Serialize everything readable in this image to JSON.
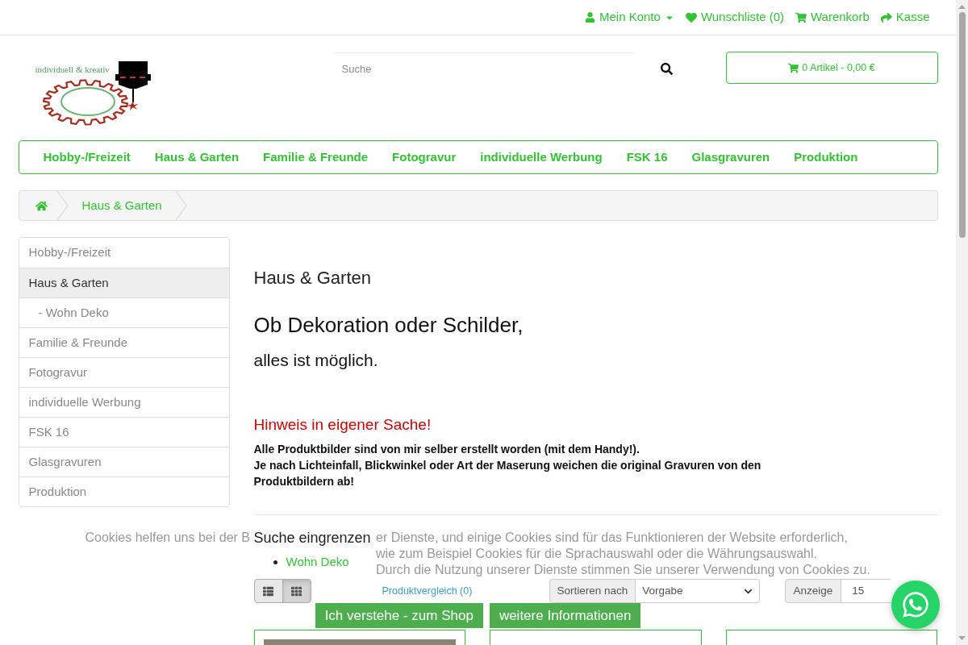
{
  "top_links": [
    {
      "kind": "account",
      "label": "Mein Konto",
      "dropdown": true
    },
    {
      "kind": "wishlist",
      "label": "Wunschliste (0)",
      "dropdown": false
    },
    {
      "kind": "cart",
      "label": "Warenkorb",
      "dropdown": false
    },
    {
      "kind": "checkout",
      "label": "Kasse",
      "dropdown": false
    }
  ],
  "logo": {
    "tagline": "individuell & kreativ"
  },
  "search": {
    "placeholder": "Suche"
  },
  "cart_button": {
    "label": "0 Artikel - 0,00 €"
  },
  "nav": [
    "Hobby-/Freizeit",
    "Haus & Garten",
    "Familie & Freunde",
    "Fotogravur",
    "individuelle Werbung",
    "FSK 16",
    "Glasgravuren",
    "Produktion"
  ],
  "breadcrumb": [
    {
      "kind": "home"
    },
    {
      "kind": "link",
      "label": "Haus & Garten"
    }
  ],
  "sidebar": {
    "items": [
      {
        "label": "Hobby-/Freizeit",
        "selected": false
      },
      {
        "label": "Haus & Garten",
        "selected": true,
        "children": [
          {
            "label": "- Wohn Deko",
            "selected": false
          }
        ]
      },
      {
        "label": "Familie & Freunde",
        "selected": false
      },
      {
        "label": "Fotogravur",
        "selected": false
      },
      {
        "label": "individuelle Werbung",
        "selected": false
      },
      {
        "label": "FSK 16",
        "selected": false
      },
      {
        "label": "Glasgravuren",
        "selected": false
      },
      {
        "label": "Produktion",
        "selected": false
      }
    ]
  },
  "content": {
    "title": "Haus & Garten",
    "headline": "Ob Dekoration oder Schilder,",
    "subline": "alles ist möglich.",
    "notice_title": "Hinweis in eigener Sache!",
    "notice_lines": [
      "Alle Produktbilder sind von mir selber erstellt worden (mit dem Handy!).",
      "Je nach Lichteinfall, Blickwinkel oder Art der Maserung weichen die original Gravuren von den Produktbildern ab!"
    ]
  },
  "refine": {
    "title": "Suche eingrenzen",
    "items": [
      "Wohn Deko"
    ]
  },
  "toolbar": {
    "view_buttons": [
      {
        "kind": "list",
        "selected": false
      },
      {
        "kind": "grid",
        "selected": true
      }
    ],
    "compare_link": "Produktvergleich (0)",
    "sort": {
      "label": "Sortieren nach",
      "value": "Vorgabe"
    },
    "limit": {
      "label": "Anzeige",
      "value": "15"
    }
  },
  "product_cards": [
    {
      "photo": true
    },
    {
      "photo": false
    },
    {
      "photo": false
    }
  ],
  "cookie_banner": {
    "lines": [
      {
        "parts": [
          "Cookies helfen uns bei der B",
          "er Dienste, und einige Cookies sind für das Funktionieren der Website erforderlich,"
        ]
      },
      {
        "parts": [
          "wie zum Beispiel Cookies für die Sprachauswahl oder die Währungsauswahl."
        ]
      },
      {
        "parts": [
          "Durch die Nutzung unserer Dienste stimmen Sie unserer Verwendung von Cookies zu."
        ]
      }
    ],
    "buttons": [
      "Ich verstehe - zum Shop",
      "weitere Informationen"
    ]
  }
}
